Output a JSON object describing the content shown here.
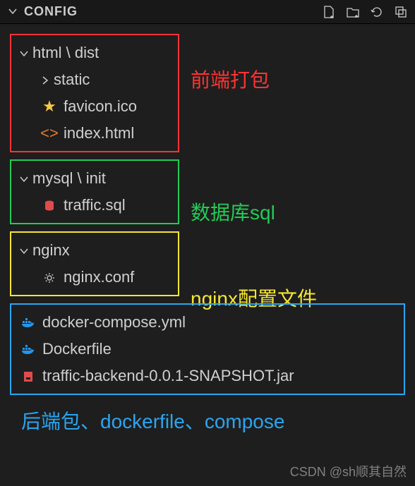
{
  "header": {
    "title": "CONFIG"
  },
  "groups": {
    "html_dist": {
      "folder": "html \\ dist",
      "children": {
        "static": "static",
        "favicon": "favicon.ico",
        "index": "index.html"
      },
      "annotation": "前端打包"
    },
    "mysql_init": {
      "folder": "mysql \\ init",
      "children": {
        "traffic_sql": "traffic.sql"
      },
      "annotation": "数据库sql"
    },
    "nginx": {
      "folder": "nginx",
      "children": {
        "nginx_conf": "nginx.conf"
      },
      "annotation": "nginx配置文件"
    },
    "root_files": {
      "compose": "docker-compose.yml",
      "dockerfile": "Dockerfile",
      "jar": "traffic-backend-0.0.1-SNAPSHOT.jar"
    }
  },
  "bottom_annotation": "后端包、dockerfile、compose",
  "watermark": "CSDN @sh顺其自然"
}
